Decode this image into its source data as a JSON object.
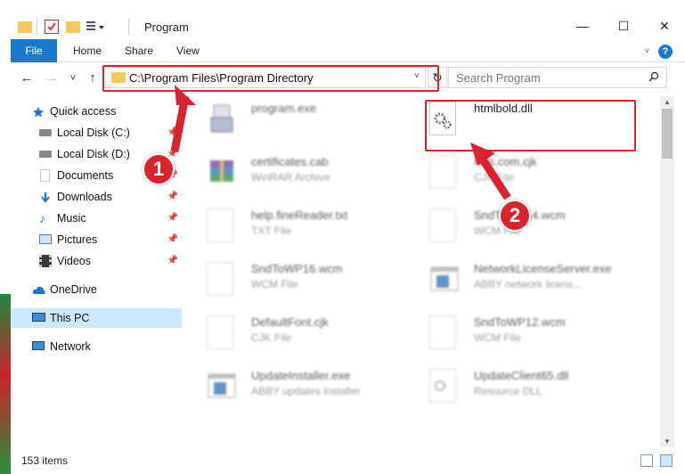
{
  "window": {
    "title": "Program",
    "minimize": "—",
    "maximize": "☐",
    "close": "✕"
  },
  "ribbon": {
    "tabs": [
      "File",
      "Home",
      "Share",
      "View"
    ],
    "help": "?"
  },
  "navigation": {
    "back": "←",
    "forward": "→",
    "recent": "˅",
    "up": "↑",
    "address": "C:\\Program Files\\Program Directory",
    "refresh": "↻",
    "search_placeholder": "Search Program"
  },
  "sidebar": {
    "items": [
      {
        "label": "Quick access",
        "icon": "star-icon"
      },
      {
        "label": "Local Disk (C:)",
        "icon": "drive-icon",
        "pinned": true
      },
      {
        "label": "Local Disk (D:)",
        "icon": "drive-icon",
        "pinned": true
      },
      {
        "label": "Documents",
        "icon": "documents-icon",
        "pinned": true
      },
      {
        "label": "Downloads",
        "icon": "downloads-icon",
        "pinned": true
      },
      {
        "label": "Music",
        "icon": "music-icon",
        "pinned": true
      },
      {
        "label": "Pictures",
        "icon": "pictures-icon",
        "pinned": true
      },
      {
        "label": "Videos",
        "icon": "videos-icon",
        "pinned": true
      },
      {
        "label": "OneDrive",
        "icon": "cloud-icon"
      },
      {
        "label": "This PC",
        "icon": "computer-icon",
        "selected": true
      },
      {
        "label": "Network",
        "icon": "network-icon"
      }
    ]
  },
  "files": [
    {
      "name": "program.exe",
      "type": "",
      "icon": "installer-icon"
    },
    {
      "name": "htmlbold.dll",
      "type": "",
      "icon": "gear-file-icon",
      "highlighted": true
    },
    {
      "name": "certificates.cab",
      "type": "WinRAR Archive",
      "icon": "archive-icon"
    },
    {
      "name": "Rus.com.cjk",
      "type": "CJK File",
      "icon": "document-icon"
    },
    {
      "name": "help.fineReader.txt",
      "type": "TXT File",
      "icon": "document-icon"
    },
    {
      "name": "SndToWP14.wcm",
      "type": "WCM File",
      "icon": "document-icon"
    },
    {
      "name": "SndToWP16.wcm",
      "type": "WCM File",
      "icon": "document-icon"
    },
    {
      "name": "NetworkLicenseServer.exe",
      "type": "ABBY network licens...",
      "icon": "app-window-icon"
    },
    {
      "name": "DefaultFont.cjk",
      "type": "CJK File",
      "icon": "document-icon"
    },
    {
      "name": "SndToWP12.wcm",
      "type": "WCM File",
      "icon": "document-icon"
    },
    {
      "name": "UpdateInstaller.exe",
      "type": "ABBY updates installer",
      "icon": "app-window-icon"
    },
    {
      "name": "UpdateClient65.dll",
      "type": "Resource DLL",
      "icon": "gear-file-icon"
    }
  ],
  "status": {
    "item_count": "153 items"
  },
  "callouts": [
    "1",
    "2"
  ],
  "colors": {
    "accent": "#1979ca",
    "highlight": "#d9232f",
    "selection": "#cce8ff"
  }
}
